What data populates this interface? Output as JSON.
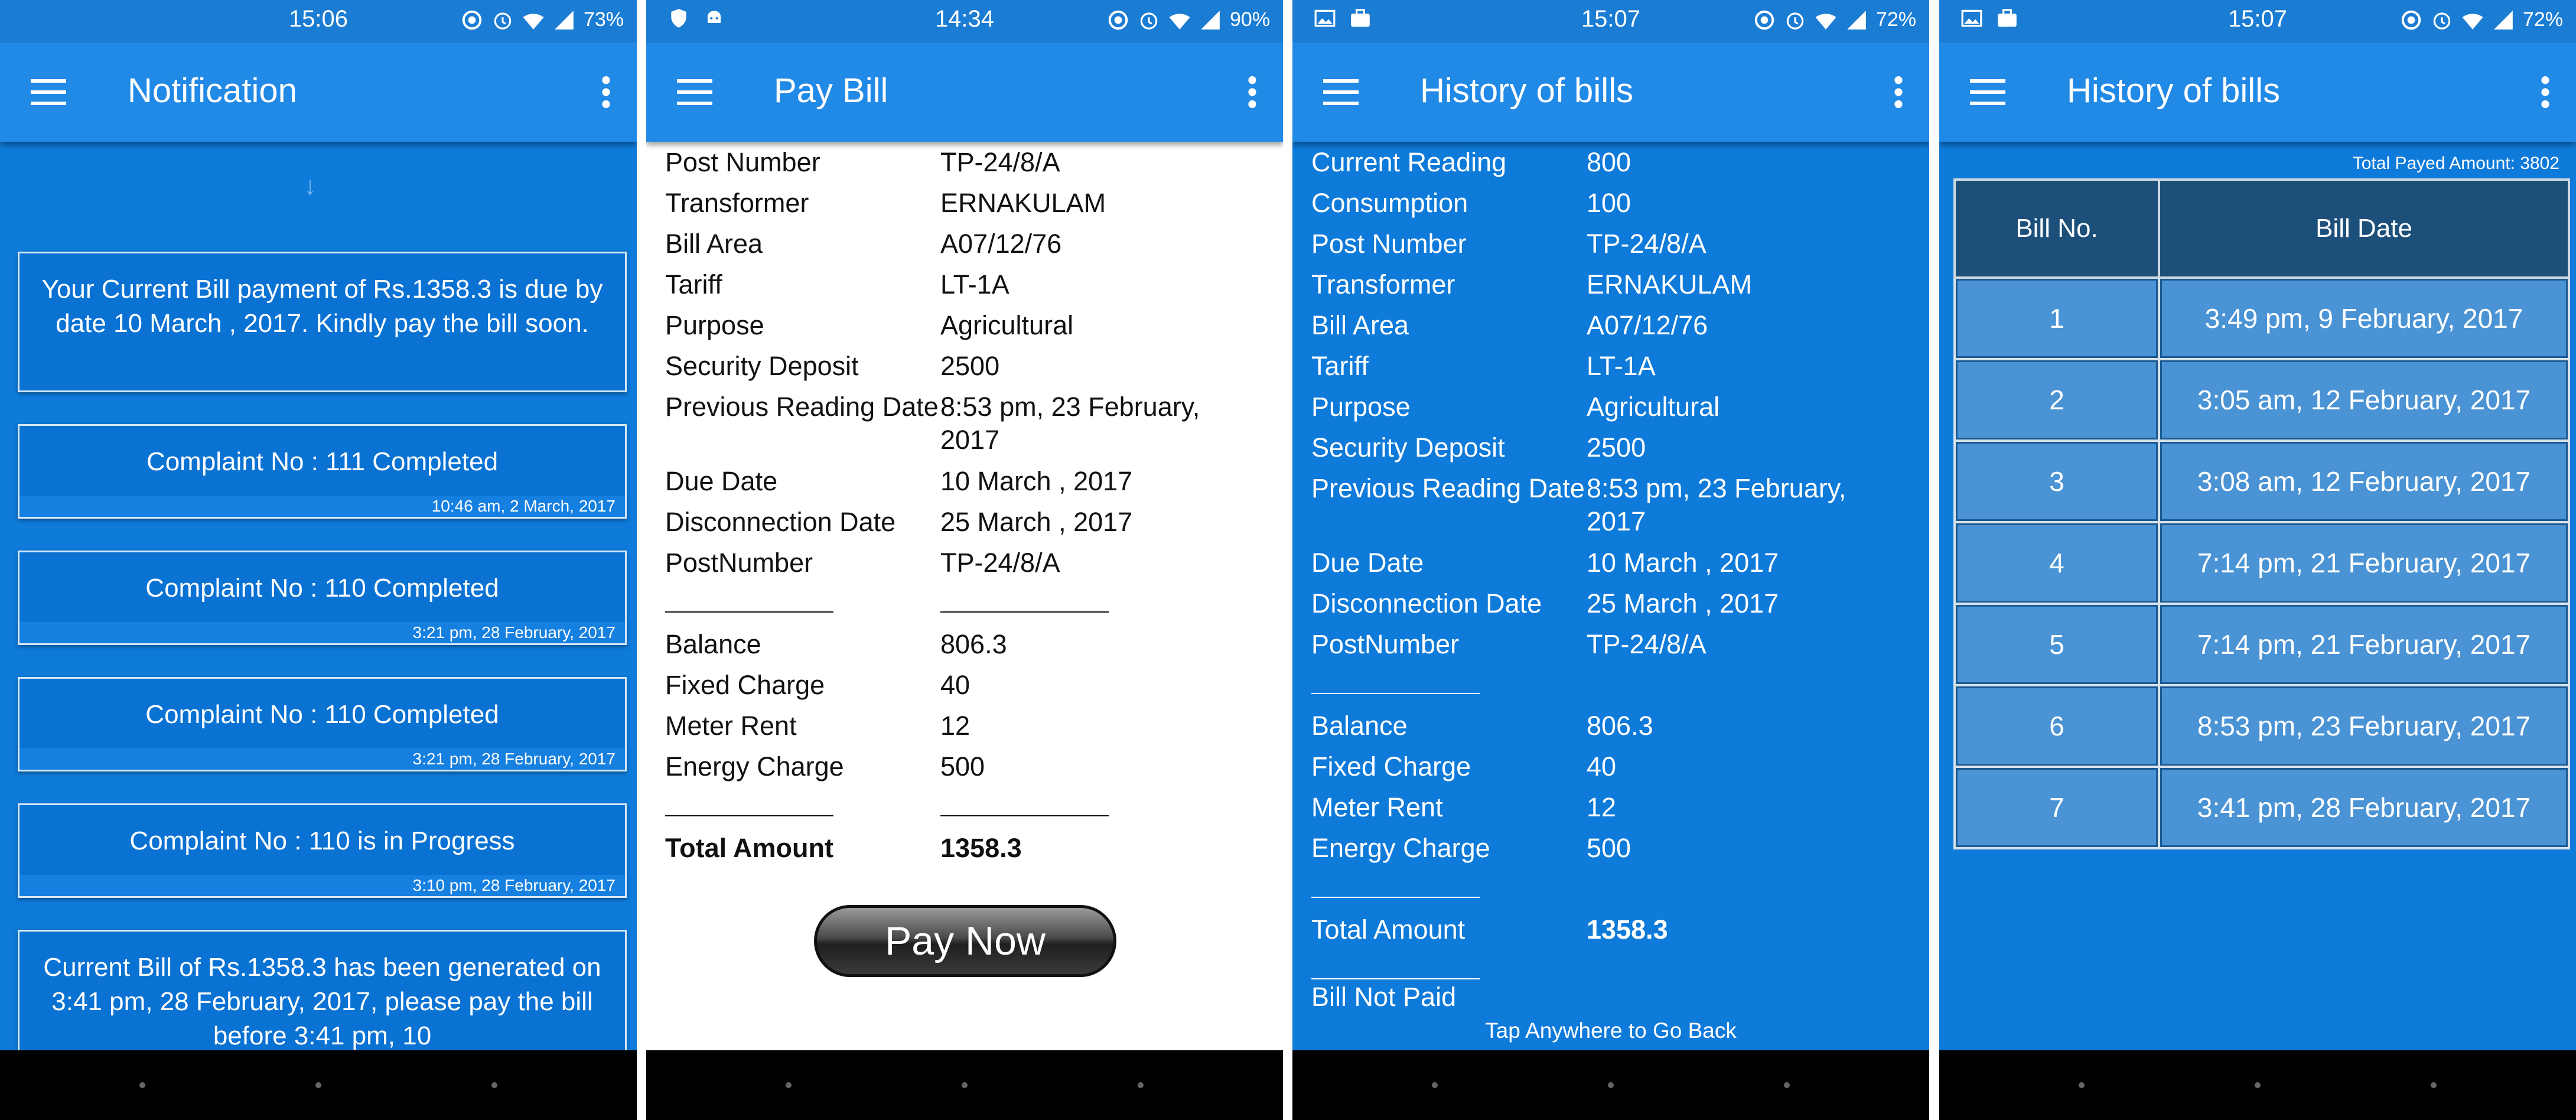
{
  "colors": {
    "appbar": "#2189e6",
    "content_blue": "#0e7ad9",
    "statusbar": "#1b7cd3",
    "table_header": "#1c4f7a",
    "table_cell": "#4a93d4"
  },
  "screens": [
    {
      "status": {
        "time": "15:06",
        "battery": "73%",
        "left_icons": []
      },
      "title": "Notification",
      "notifications": [
        {
          "text": "Your Current Bill payment of Rs.1358.3 is due by date 10 March , 2017. Kindly pay the bill soon.",
          "stamp": ""
        },
        {
          "text": "Complaint No : 111 Completed",
          "stamp": "10:46 am, 2 March, 2017"
        },
        {
          "text": "Complaint No : 110 Completed",
          "stamp": "3:21 pm, 28 February, 2017"
        },
        {
          "text": "Complaint No : 110 Completed",
          "stamp": "3:21 pm, 28 February, 2017"
        },
        {
          "text": "Complaint No : 110 is in Progress",
          "stamp": "3:10 pm, 28 February, 2017"
        },
        {
          "text": "Current Bill of Rs.1358.3 has been generated on 3:41 pm, 28 February, 2017, please pay the bill before 3:41 pm, 10",
          "stamp": ""
        }
      ]
    },
    {
      "status": {
        "time": "14:34",
        "battery": "90%",
        "left_icons": [
          "shield-icon",
          "android-icon"
        ]
      },
      "title": "Pay Bill",
      "rows": [
        [
          "Post Number",
          "TP-24/8/A"
        ],
        [
          "Transformer",
          "ERNAKULAM"
        ],
        [
          "Bill Area",
          "A07/12/76"
        ],
        [
          "Tariff",
          "LT-1A"
        ],
        [
          "Purpose",
          "Agricultural"
        ],
        [
          "Security Deposit",
          "2500"
        ],
        [
          "Previous Reading Date",
          "8:53 pm, 23 February, 2017"
        ],
        [
          "Due Date",
          "10 March , 2017"
        ],
        [
          "Disconnection Date",
          "25 March , 2017"
        ],
        [
          "PostNumber",
          "TP-24/8/A"
        ],
        [
          "Balance",
          "806.3"
        ],
        [
          "Fixed Charge",
          "40"
        ],
        [
          "Meter Rent",
          "12"
        ],
        [
          "Energy Charge",
          "500"
        ],
        [
          "Total Amount",
          "1358.3"
        ]
      ],
      "pay_button": "Pay Now"
    },
    {
      "status": {
        "time": "15:07",
        "battery": "72%",
        "left_icons": [
          "image-icon",
          "briefcase-icon"
        ]
      },
      "title": "History of bills",
      "rows": [
        [
          "Current Reading",
          "800"
        ],
        [
          "Consumption",
          "100"
        ],
        [
          "Post Number",
          "TP-24/8/A"
        ],
        [
          "Transformer",
          "ERNAKULAM"
        ],
        [
          "Bill Area",
          "A07/12/76"
        ],
        [
          "Tariff",
          "LT-1A"
        ],
        [
          "Purpose",
          "Agricultural"
        ],
        [
          "Security Deposit",
          "2500"
        ],
        [
          "Previous Reading Date",
          "8:53 pm, 23 February, 2017"
        ],
        [
          "Due Date",
          "10 March , 2017"
        ],
        [
          "Disconnection Date",
          "25 March , 2017"
        ],
        [
          "PostNumber",
          "TP-24/8/A"
        ],
        [
          "Balance",
          "806.3"
        ],
        [
          "Fixed Charge",
          "40"
        ],
        [
          "Meter Rent",
          "12"
        ],
        [
          "Energy Charge",
          "500"
        ],
        [
          "Total Amount",
          "1358.3"
        ]
      ],
      "bill_status": "Bill Not Paid",
      "tap_hint": "Tap Anywhere to Go Back"
    },
    {
      "status": {
        "time": "15:07",
        "battery": "72%",
        "left_icons": [
          "image-icon",
          "briefcase-icon"
        ]
      },
      "title": "History of bills",
      "total_payed": "Total Payed Amount: 3802",
      "table": {
        "headers": [
          "Bill No.",
          "Bill Date"
        ],
        "rows": [
          [
            "1",
            "3:49 pm, 9 February, 2017"
          ],
          [
            "2",
            "3:05 am, 12 February, 2017"
          ],
          [
            "3",
            "3:08 am, 12 February, 2017"
          ],
          [
            "4",
            "7:14 pm, 21 February, 2017"
          ],
          [
            "5",
            "7:14 pm, 21 February, 2017"
          ],
          [
            "6",
            "8:53 pm, 23 February, 2017"
          ],
          [
            "7",
            "3:41 pm, 28 February, 2017"
          ]
        ]
      }
    }
  ]
}
